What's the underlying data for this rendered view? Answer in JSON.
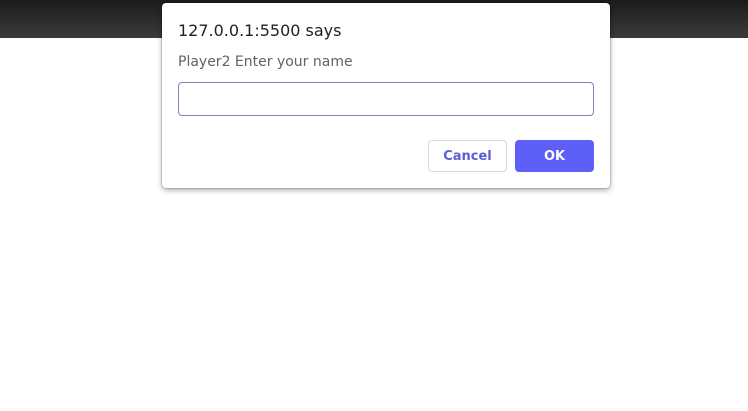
{
  "window": {
    "topbar_color": "#1f1f1f"
  },
  "dialog": {
    "title": "127.0.0.1:5500 says",
    "message": "Player2 Enter your name",
    "input_value": "",
    "cancel_label": "Cancel",
    "ok_label": "OK",
    "accent_color": "#5e5ff6"
  }
}
